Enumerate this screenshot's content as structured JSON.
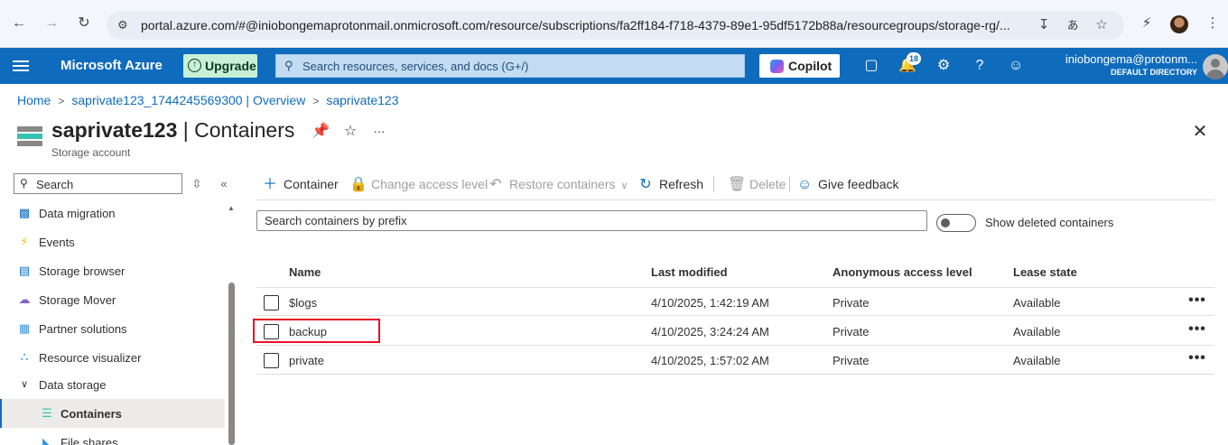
{
  "browser": {
    "url": "portal.azure.com/#@iniobongemaprotonmail.onmicrosoft.com/resource/subscriptions/fa2ff184-f718-4379-89e1-95df5172b88a/resourcegroups/storage-rg/..."
  },
  "topbar": {
    "brand": "Microsoft Azure",
    "upgrade_label": "Upgrade",
    "search_placeholder": "Search resources, services, and docs (G+/)",
    "copilot_label": "Copilot",
    "notification_count": "18",
    "user_email": "iniobongema@protonm...",
    "user_directory": "DEFAULT DIRECTORY"
  },
  "breadcrumb": {
    "items": [
      "Home",
      "saprivate123_1744245569300 | Overview",
      "saprivate123"
    ]
  },
  "header": {
    "resource_name": "saprivate123",
    "separator": "|",
    "page_name": "Containers",
    "subtitle": "Storage account",
    "more_label": "···"
  },
  "sidebar": {
    "search_placeholder": "Search",
    "items": [
      {
        "label": "Data migration",
        "icon": "data-migration-icon"
      },
      {
        "label": "Events",
        "icon": "lightning-icon"
      },
      {
        "label": "Storage browser",
        "icon": "storage-browser-icon"
      },
      {
        "label": "Storage Mover",
        "icon": "cloud-icon"
      },
      {
        "label": "Partner solutions",
        "icon": "partner-icon"
      },
      {
        "label": "Resource visualizer",
        "icon": "visualizer-icon"
      },
      {
        "label": "Data storage",
        "icon": "chevron-down-icon"
      },
      {
        "label": "Containers",
        "icon": "containers-icon"
      },
      {
        "label": "File shares",
        "icon": "file-shares-icon"
      }
    ]
  },
  "toolbar": {
    "container": "Container",
    "change_access": "Change access level",
    "restore": "Restore containers",
    "refresh": "Refresh",
    "delete": "Delete",
    "feedback": "Give feedback"
  },
  "filter": {
    "prefix_placeholder": "Search containers by prefix",
    "show_deleted": "Show deleted containers"
  },
  "table": {
    "columns": [
      "Name",
      "Last modified",
      "Anonymous access level",
      "Lease state"
    ],
    "rows": [
      {
        "name": "$logs",
        "modified": "4/10/2025, 1:42:19 AM",
        "access": "Private",
        "lease": "Available"
      },
      {
        "name": "backup",
        "modified": "4/10/2025, 3:24:24 AM",
        "access": "Private",
        "lease": "Available"
      },
      {
        "name": "private",
        "modified": "4/10/2025, 1:57:02 AM",
        "access": "Private",
        "lease": "Available"
      }
    ],
    "row_menu": "•••"
  },
  "colors": {
    "azure_blue": "#0f6cbd",
    "highlight_red": "#e81123",
    "upgrade_green": "#c7f0d6"
  }
}
